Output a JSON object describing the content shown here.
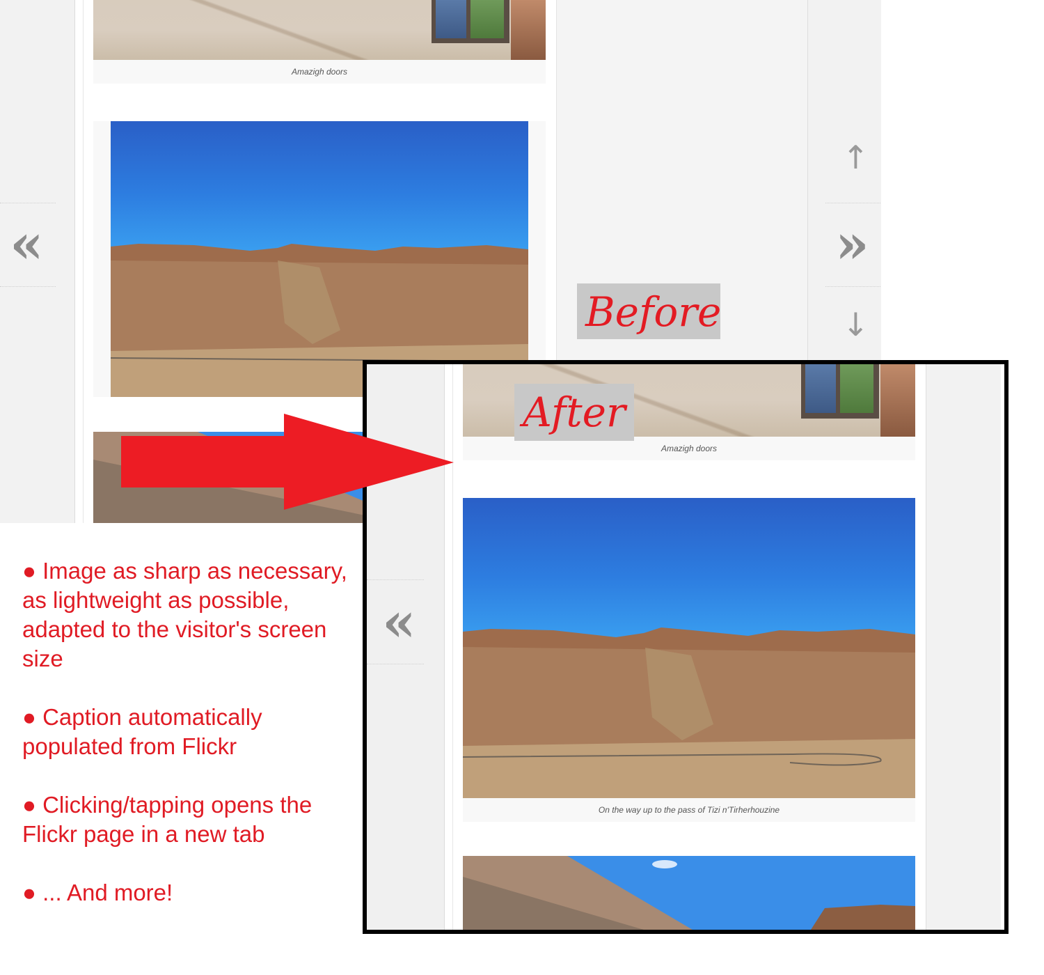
{
  "before": {
    "caption_doors": "Amazigh doors",
    "label": "Before",
    "nav": {
      "prev_glyph": "«",
      "next_glyph": "»",
      "up_glyph": "↑",
      "down_glyph": "↓"
    }
  },
  "after": {
    "label": "After",
    "caption_doors": "Amazigh doors",
    "caption_mountain": "On the way up to the pass of Tizi n'Tirherhouzine",
    "nav": {
      "prev_glyph": "«"
    }
  },
  "notes": [
    "● Image as sharp as necessary, as lightweight as possible, adapted to the visitor's screen size",
    "● Caption automatically populated from Flickr",
    "● Clicking/tapping opens the Flickr page in a new tab",
    "● ... And more!"
  ],
  "colors": {
    "annotation_red": "#e01b24",
    "label_bg": "#c8c8c8",
    "frame": "#000000"
  }
}
